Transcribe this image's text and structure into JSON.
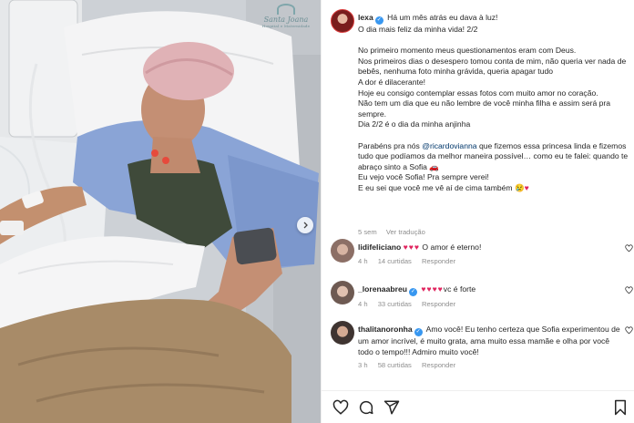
{
  "post": {
    "watermark": {
      "name": "Santa Joana",
      "subtitle": "Hospital e Maternidade"
    },
    "author": "lexa",
    "caption_lines": [
      "Há um mês atrás eu dava à luz!",
      "O dia mais feliz da minha vida! 2/2",
      "",
      "No primeiro momento meus questionamentos eram com Deus.",
      "Nos primeiros dias o desespero tomou conta de mim, não queria ver nada de bebês, nenhuma foto minha grávida, queria apagar tudo",
      "A dor é dilacerante!",
      "Hoje eu consigo contemplar essas fotos com muito amor no coração.",
      "Não tem um dia que eu não lembre de você minha filha e assim será pra sempre.",
      "Dia 2/2 é o dia da minha anjinha",
      ""
    ],
    "caption_para2": {
      "before": "Parabéns pra nós ",
      "mention": "@ricardovianna",
      "after": " que fizemos essa princesa linda e fizemos tudo que podíamos da melhor maneira possível… como eu te falei: quando te abraço sinto a Sofia ",
      "line2": "Eu vejo você Sofia! Pra sempre verei!",
      "line3": "E eu sei que você me vê aí de cima também "
    },
    "time": "5 sem",
    "see_translation": "Ver tradução"
  },
  "comments": [
    {
      "user": "lidifeliciano",
      "verified": false,
      "hearts": "♥♥♥",
      "text": " O amor é eterno!",
      "time": "4 h",
      "likes": "14 curtidas",
      "reply": "Responder"
    },
    {
      "user": "_lorenaabreu",
      "verified": true,
      "hearts": "♥♥♥♥",
      "text": "vc é forte",
      "time": "4 h",
      "likes": "33 curtidas",
      "reply": "Responder"
    },
    {
      "user": "thalitanoronha",
      "verified": true,
      "hearts": "",
      "text": "Amo você! Eu tenho certeza que Sofia experimentou de um amor incrível, é muito grata, ama muito essa mamãe e olha por você todo o tempo!!! Admiro muito você!",
      "time": "3 h",
      "likes": "58 curtidas",
      "reply": "Responder"
    }
  ],
  "icons": {
    "like": "heart-icon",
    "comment": "comment-icon",
    "share": "share-icon",
    "save": "bookmark-icon",
    "next": "chevron-right-icon"
  },
  "colors": {
    "link": "#00376b",
    "heart": "#e0245e",
    "verified": "#3897f0",
    "meta": "#8e8e8e"
  }
}
